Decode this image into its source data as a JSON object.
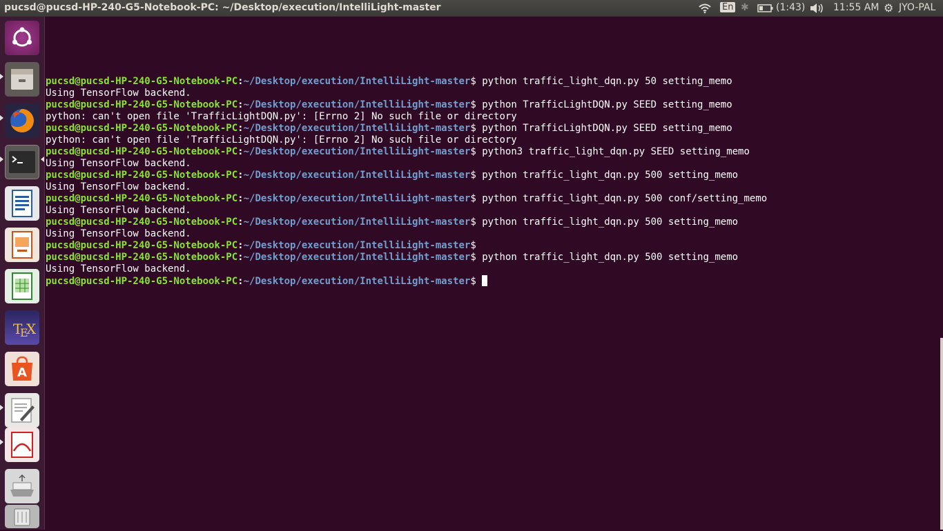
{
  "top_panel": {
    "window_title": "pucsd@pucsd-HP-240-G5-Notebook-PC: ~/Desktop/execution/IntelliLight-master",
    "keyboard_layout": "En",
    "battery_time": "(1:43)",
    "clock": "11:55 AM",
    "user_name": "JYO-PAL"
  },
  "launcher": {
    "items": [
      {
        "name": "Search your computer",
        "icon": "ubuntu-dash-icon",
        "color": "#7b2e6d"
      },
      {
        "name": "Files",
        "icon": "files-icon",
        "color": "#8a8478"
      },
      {
        "name": "Firefox Web Browser",
        "icon": "firefox-icon",
        "color": "#e66000"
      },
      {
        "name": "Terminal",
        "icon": "terminal-icon",
        "color": "#2e2e2e"
      },
      {
        "name": "LibreOffice Writer",
        "icon": "libreoffice-writer-icon",
        "color": "#2a5d9e"
      },
      {
        "name": "LibreOffice Impress",
        "icon": "libreoffice-impress-icon",
        "color": "#c7561e"
      },
      {
        "name": "LibreOffice Calc",
        "icon": "libreoffice-calc-icon",
        "color": "#2e8a2e"
      },
      {
        "name": "TeXworks",
        "icon": "texworks-icon",
        "color": "#3a2e8a"
      },
      {
        "name": "Ubuntu Software",
        "icon": "ubuntu-software-icon",
        "color": "#e95420"
      },
      {
        "name": "Text Editor",
        "icon": "text-editor-icon",
        "color": "#dcdcd8"
      },
      {
        "name": "Document Viewer",
        "icon": "document-viewer-icon",
        "color": "#cc2222"
      },
      {
        "name": "USB Drive",
        "icon": "usb-drive-icon",
        "color": "#d0d0d0"
      },
      {
        "name": "Trash",
        "icon": "trash-icon",
        "color": "#b8b8b8"
      }
    ]
  },
  "terminal": {
    "lines": [
      {
        "type": "prompt",
        "user": "pucsd@pucsd-HP-240-G5-Notebook-PC",
        "path": "~/Desktop/execution/IntelliLight-master",
        "command": " python traffic_light_dqn.py 50 setting_memo"
      },
      {
        "type": "output",
        "text": "Using TensorFlow backend."
      },
      {
        "type": "prompt",
        "user": "pucsd@pucsd-HP-240-G5-Notebook-PC",
        "path": "~/Desktop/execution/IntelliLight-master",
        "command": " python TrafficLightDQN.py SEED setting_memo"
      },
      {
        "type": "output",
        "text": "python: can't open file 'TrafficLightDQN.py': [Errno 2] No such file or directory"
      },
      {
        "type": "prompt",
        "user": "pucsd@pucsd-HP-240-G5-Notebook-PC",
        "path": "~/Desktop/execution/IntelliLight-master",
        "command": " python TrafficLightDQN.py SEED setting_memo"
      },
      {
        "type": "output",
        "text": "python: can't open file 'TrafficLightDQN.py': [Errno 2] No such file or directory"
      },
      {
        "type": "prompt",
        "user": "pucsd@pucsd-HP-240-G5-Notebook-PC",
        "path": "~/Desktop/execution/IntelliLight-master",
        "command": " python3 traffic_light_dqn.py SEED setting_memo"
      },
      {
        "type": "output",
        "text": "Using TensorFlow backend."
      },
      {
        "type": "prompt",
        "user": "pucsd@pucsd-HP-240-G5-Notebook-PC",
        "path": "~/Desktop/execution/IntelliLight-master",
        "command": " python traffic_light_dqn.py 500 setting_memo"
      },
      {
        "type": "output",
        "text": "Using TensorFlow backend."
      },
      {
        "type": "prompt",
        "user": "pucsd@pucsd-HP-240-G5-Notebook-PC",
        "path": "~/Desktop/execution/IntelliLight-master",
        "command": " python traffic_light_dqn.py 500 conf/setting_memo"
      },
      {
        "type": "output",
        "text": "Using TensorFlow backend."
      },
      {
        "type": "prompt",
        "user": "pucsd@pucsd-HP-240-G5-Notebook-PC",
        "path": "~/Desktop/execution/IntelliLight-master",
        "command": " python traffic_light_dqn.py 500 setting_memo"
      },
      {
        "type": "output",
        "text": "Using TensorFlow backend."
      },
      {
        "type": "prompt",
        "user": "pucsd@pucsd-HP-240-G5-Notebook-PC",
        "path": "~/Desktop/execution/IntelliLight-master",
        "command": ""
      },
      {
        "type": "prompt",
        "user": "pucsd@pucsd-HP-240-G5-Notebook-PC",
        "path": "~/Desktop/execution/IntelliLight-master",
        "command": " python traffic_light_dqn.py 500 setting_memo"
      },
      {
        "type": "output",
        "text": "Using TensorFlow backend."
      }
    ],
    "current_prompt": {
      "user": "pucsd@pucsd-HP-240-G5-Notebook-PC",
      "path": "~/Desktop/execution/IntelliLight-master",
      "command": " "
    }
  }
}
